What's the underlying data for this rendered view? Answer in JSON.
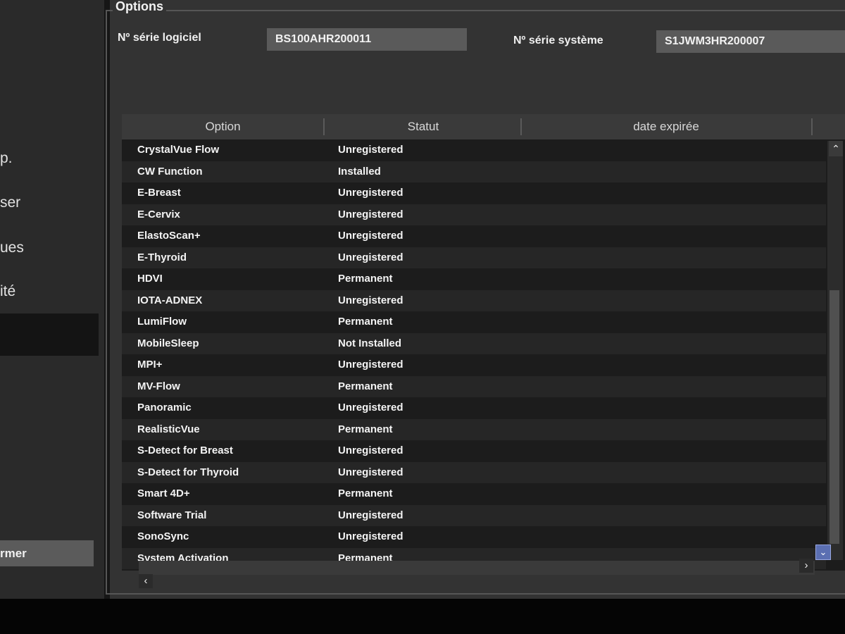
{
  "sidebar": {
    "items": [
      {
        "label": "p."
      },
      {
        "label": "ser"
      },
      {
        "label": "ues"
      },
      {
        "label": "ité"
      }
    ],
    "close_label": "rmer"
  },
  "options": {
    "title": "Options",
    "software_serial_label": "Nº série logiciel",
    "software_serial_value": "BS100AHR200011",
    "system_serial_label": "Nº série système",
    "system_serial_value": "S1JWM3HR200007"
  },
  "table": {
    "columns": [
      "Option",
      "Statut",
      "date expirée"
    ],
    "rows": [
      {
        "option": "CrystalVue Flow",
        "status": "Unregistered"
      },
      {
        "option": "CW Function",
        "status": "Installed"
      },
      {
        "option": "E-Breast",
        "status": "Unregistered"
      },
      {
        "option": "E-Cervix",
        "status": "Unregistered"
      },
      {
        "option": "ElastoScan+",
        "status": "Unregistered"
      },
      {
        "option": "E-Thyroid",
        "status": "Unregistered"
      },
      {
        "option": "HDVI",
        "status": "Permanent"
      },
      {
        "option": "IOTA-ADNEX",
        "status": "Unregistered"
      },
      {
        "option": "LumiFlow",
        "status": "Permanent"
      },
      {
        "option": "MobileSleep",
        "status": "Not Installed"
      },
      {
        "option": "MPI+",
        "status": "Unregistered"
      },
      {
        "option": "MV-Flow",
        "status": "Permanent"
      },
      {
        "option": "Panoramic",
        "status": "Unregistered"
      },
      {
        "option": "RealisticVue",
        "status": "Permanent"
      },
      {
        "option": "S-Detect for Breast",
        "status": "Unregistered"
      },
      {
        "option": "S-Detect for Thyroid",
        "status": "Unregistered"
      },
      {
        "option": "Smart 4D+",
        "status": "Permanent"
      },
      {
        "option": "Software Trial",
        "status": "Unregistered"
      },
      {
        "option": "SonoSync",
        "status": "Unregistered"
      },
      {
        "option": "System Activation",
        "status": "Permanent"
      }
    ]
  },
  "scroll": {
    "up_icon": "chevron-up-icon",
    "down_icon": "chevron-down-icon",
    "left_icon": "chevron-left-icon",
    "right_icon": "chevron-right-icon"
  }
}
